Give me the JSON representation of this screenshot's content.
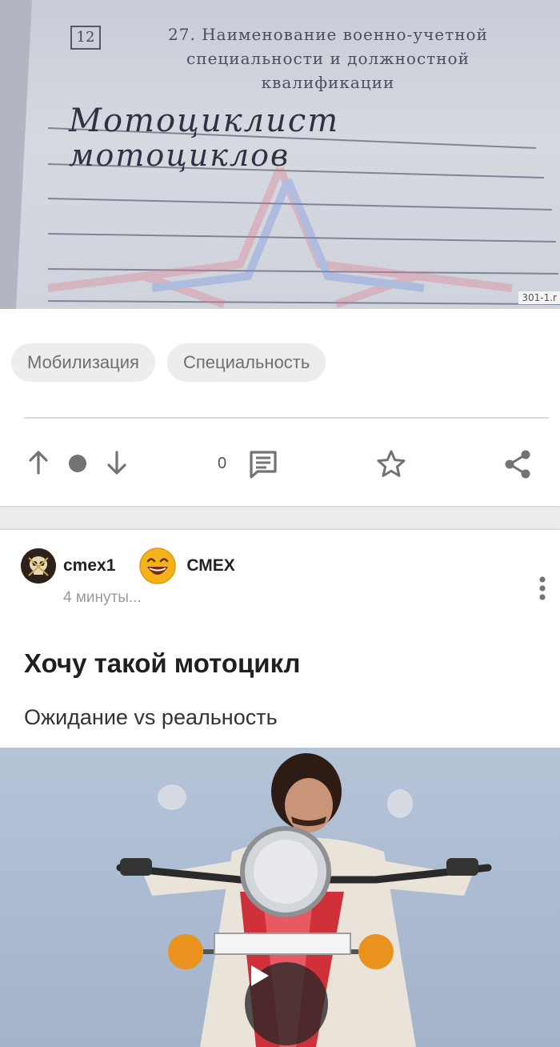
{
  "post1": {
    "document": {
      "number": "12",
      "heading_lines": [
        "27. Наименование военно-учетной",
        "специальности и должностной",
        "квалификации"
      ],
      "handwriting_lines": [
        "Мотоциклист",
        "мотоциклов"
      ],
      "watermark": "301-1.r"
    },
    "tags": [
      "Мобилизация",
      "Специальность"
    ],
    "actions": {
      "comment_count": "0"
    }
  },
  "post2": {
    "author": "cmex1",
    "community": "СМЕХ",
    "time": "4 минуты...",
    "title": "Хочу такой мотоцикл",
    "subtitle": "Ожидание vs реальность"
  },
  "colors": {
    "card_bg": "#ffffff",
    "page_bg": "#ececec",
    "tag_bg": "#ededed",
    "icon_gray": "#737373",
    "motorcycle_red": "#d0303a"
  },
  "icons": {
    "upvote": "arrow-up-icon",
    "downvote": "arrow-down-icon",
    "comments": "comment-icon",
    "save": "star-icon",
    "share": "share-icon",
    "more": "more-vertical-icon",
    "play": "play-icon"
  }
}
